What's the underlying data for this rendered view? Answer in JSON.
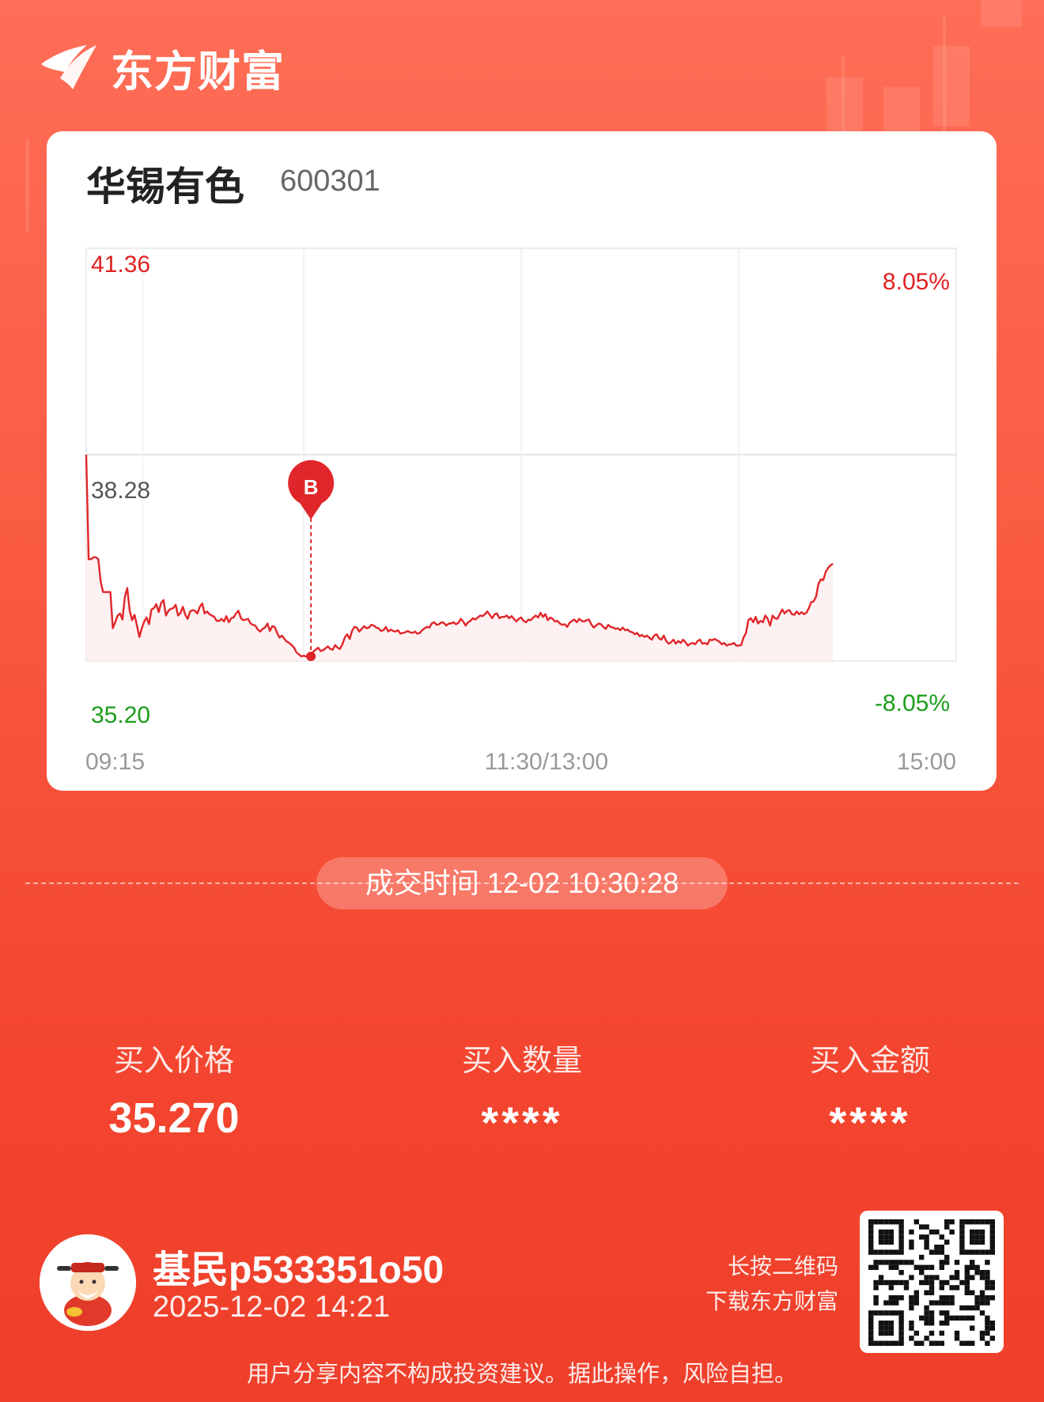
{
  "brand": {
    "name": "东方财富"
  },
  "stock": {
    "name": "华锡有色",
    "code": "600301"
  },
  "chart_data": {
    "type": "line",
    "title": "",
    "y_labels": {
      "high": "41.36",
      "prev_close": "38.28",
      "low": "35.20"
    },
    "pct_labels": {
      "high": "8.05%",
      "low": "-8.05%"
    },
    "x_labels": [
      "09:15",
      "11:30/13:00",
      "15:00"
    ],
    "ylim": [
      35.2,
      41.36
    ],
    "grid": true,
    "series": [
      {
        "values": [
          38.28,
          36.72,
          36.72,
          36.75,
          36.75,
          36.72,
          36.38,
          36.23,
          36.23,
          36.23,
          36.23,
          35.69,
          35.78,
          35.88,
          35.91,
          35.82,
          36.16,
          36.29,
          35.95,
          35.81,
          35.89,
          35.73,
          35.56,
          35.69,
          35.79,
          35.85,
          35.75,
          35.97,
          35.99,
          36.05,
          35.93,
          36.07,
          36.11,
          35.88,
          35.95,
          35.98,
          35.99,
          36.04,
          35.88,
          35.92,
          36.01,
          35.89,
          35.83,
          35.94,
          35.96,
          35.95,
          35.91,
          36.01,
          36.06,
          35.91,
          35.94,
          35.9,
          35.88,
          35.86,
          35.8,
          35.8,
          35.83,
          35.79,
          35.87,
          35.78,
          35.84,
          35.85,
          35.91,
          35.95,
          35.84,
          35.81,
          35.82,
          35.83,
          35.76,
          35.74,
          35.73,
          35.67,
          35.64,
          35.68,
          35.7,
          35.76,
          35.65,
          35.72,
          35.71,
          35.62,
          35.55,
          35.58,
          35.53,
          35.49,
          35.47,
          35.44,
          35.4,
          35.33,
          35.3,
          35.27,
          35.28,
          35.27,
          35.27,
          35.28,
          35.34,
          35.37,
          35.4,
          35.35,
          35.36,
          35.39,
          35.42,
          35.38,
          35.37,
          35.44,
          35.4,
          35.38,
          35.45,
          35.55,
          35.6,
          35.53,
          35.65,
          35.71,
          35.7,
          35.64,
          35.68,
          35.72,
          35.69,
          35.7,
          35.74,
          35.73,
          35.7,
          35.69,
          35.65,
          35.66,
          35.71,
          35.64,
          35.67,
          35.65,
          35.64,
          35.66,
          35.61,
          35.62,
          35.63,
          35.65,
          35.63,
          35.62,
          35.64,
          35.61,
          35.62,
          35.66,
          35.69,
          35.71,
          35.7,
          35.76,
          35.78,
          35.74,
          35.75,
          35.78,
          35.77,
          35.73,
          35.76,
          35.76,
          35.78,
          35.75,
          35.77,
          35.83,
          35.79,
          35.73,
          35.78,
          35.8,
          35.84,
          35.82,
          35.85,
          35.88,
          35.87,
          35.9,
          35.94,
          35.89,
          35.84,
          35.9,
          35.91,
          35.84,
          35.86,
          35.86,
          35.88,
          35.84,
          35.87,
          35.83,
          35.79,
          35.83,
          35.85,
          35.8,
          35.78,
          35.82,
          35.81,
          35.85,
          35.88,
          35.85,
          35.92,
          35.86,
          35.9,
          35.81,
          35.85,
          35.83,
          35.79,
          35.8,
          35.76,
          35.74,
          35.75,
          35.71,
          35.77,
          35.8,
          35.82,
          35.78,
          35.83,
          35.8,
          35.79,
          35.81,
          35.82,
          35.75,
          35.7,
          35.73,
          35.76,
          35.75,
          35.71,
          35.68,
          35.74,
          35.71,
          35.7,
          35.68,
          35.69,
          35.66,
          35.7,
          35.66,
          35.67,
          35.64,
          35.63,
          35.6,
          35.62,
          35.57,
          35.59,
          35.56,
          35.58,
          35.55,
          35.52,
          35.58,
          35.6,
          35.54,
          35.52,
          35.58,
          35.5,
          35.46,
          35.48,
          35.52,
          35.46,
          35.5,
          35.47,
          35.52,
          35.48,
          35.43,
          35.46,
          35.47,
          35.45,
          35.5,
          35.52,
          35.46,
          35.47,
          35.45,
          35.52,
          35.51,
          35.53,
          35.51,
          35.49,
          35.45,
          35.47,
          35.43,
          35.45,
          35.45,
          35.47,
          35.43,
          35.43,
          35.44,
          35.55,
          35.62,
          35.81,
          35.84,
          35.78,
          35.86,
          35.76,
          35.8,
          35.78,
          35.88,
          35.83,
          35.73,
          35.88,
          35.84,
          35.83,
          35.9,
          35.97,
          35.91,
          35.95,
          35.96,
          35.9,
          35.89,
          35.94,
          35.9,
          35.93,
          35.9,
          35.92,
          35.99,
          36.08,
          36.09,
          36.16,
          36.35,
          36.42,
          36.41,
          36.53,
          36.59,
          36.63,
          36.65
        ]
      }
    ],
    "marker": {
      "label": "B",
      "index": 93,
      "price": 35.27
    }
  },
  "trade": {
    "time_label": "成交时间 12-02 10:30:28"
  },
  "stats": [
    {
      "label": "买入价格",
      "value": "35.270"
    },
    {
      "label": "买入数量",
      "value": "****"
    },
    {
      "label": "买入金额",
      "value": "****"
    }
  ],
  "user": {
    "name": "基民p533351o50",
    "date": "2025-12-02 14:21"
  },
  "qr": {
    "hint_line1": "长按二维码",
    "hint_line2": "下载东方财富"
  },
  "disclaimer": "用户分享内容不构成投资建议。据此操作，风险自担。",
  "colors": {
    "up": "#e02020",
    "down": "#1a9e1a",
    "line": "#e0262a",
    "brand_bg": "#f7533b"
  }
}
